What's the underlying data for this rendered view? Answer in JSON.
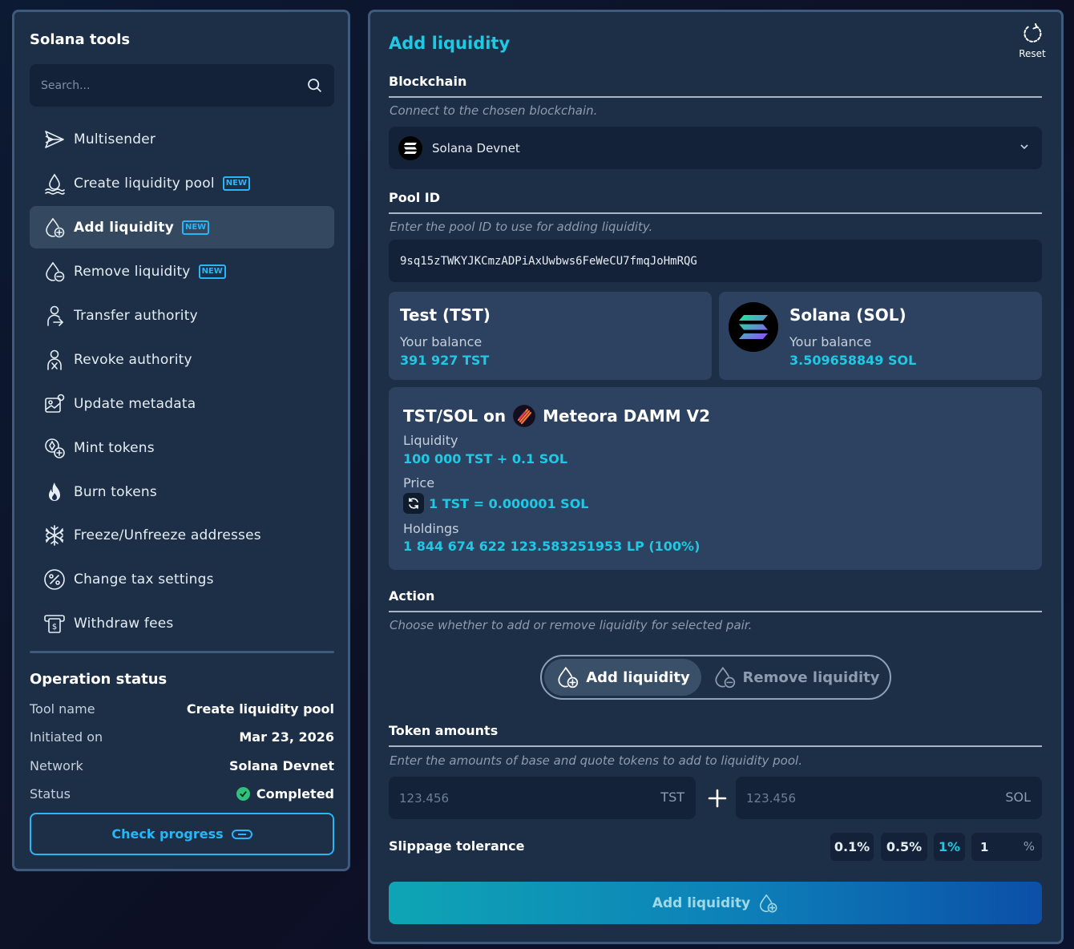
{
  "sidebar": {
    "title": "Solana tools",
    "search_placeholder": "Search...",
    "items": [
      {
        "label": "Multisender",
        "icon": "send-icon",
        "badge": ""
      },
      {
        "label": "Create liquidity pool",
        "icon": "droplet-waves-icon",
        "badge": "NEW"
      },
      {
        "label": "Add liquidity",
        "icon": "droplet-plus-icon",
        "badge": "NEW",
        "active": true
      },
      {
        "label": "Remove liquidity",
        "icon": "droplet-minus-icon",
        "badge": "NEW"
      },
      {
        "label": "Transfer authority",
        "icon": "user-transfer-icon",
        "badge": ""
      },
      {
        "label": "Revoke authority",
        "icon": "user-x-icon",
        "badge": ""
      },
      {
        "label": "Update metadata",
        "icon": "image-edit-icon",
        "badge": ""
      },
      {
        "label": "Mint tokens",
        "icon": "coins-plus-icon",
        "badge": ""
      },
      {
        "label": "Burn tokens",
        "icon": "flame-icon",
        "badge": ""
      },
      {
        "label": "Freeze/Unfreeze addresses",
        "icon": "snowflake-icon",
        "badge": ""
      },
      {
        "label": "Change tax settings",
        "icon": "percent-icon",
        "badge": ""
      },
      {
        "label": "Withdraw fees",
        "icon": "cash-withdraw-icon",
        "badge": ""
      }
    ],
    "status": {
      "title": "Operation status",
      "rows": [
        {
          "key": "Tool name",
          "value": "Create liquidity pool"
        },
        {
          "key": "Initiated on",
          "value": "Mar 23, 2026"
        },
        {
          "key": "Network",
          "value": "Solana Devnet"
        },
        {
          "key": "Status",
          "value": "Completed"
        }
      ],
      "button_label": "Check progress"
    }
  },
  "main": {
    "title": "Add liquidity",
    "reset_label": "Reset",
    "blockchain": {
      "label": "Blockchain",
      "hint": "Connect to the chosen blockchain.",
      "selected": "Solana Devnet"
    },
    "pool": {
      "label": "Pool ID",
      "hint": "Enter the pool ID to use for adding liquidity.",
      "value": "9sq15zTWKYJKCmzADPiAxUwbws6FeWeCU7fmqJoHmRQG"
    },
    "base_token": {
      "name": "Test (TST)",
      "balance_label": "Your balance",
      "balance": "391 927 TST"
    },
    "quote_token": {
      "name": "Solana (SOL)",
      "balance_label": "Your balance",
      "balance": "3.509658849 SOL"
    },
    "pair": {
      "pair_name": "TST/SOL on",
      "dex_name": "Meteora DAMM V2",
      "liquidity_label": "Liquidity",
      "liquidity_value": "100 000 TST + 0.1 SOL",
      "price_label": "Price",
      "price_value": "1 TST = 0.000001 SOL",
      "holdings_label": "Holdings",
      "holdings_value": "1 844 674 622 123.583251953 LP (100%)"
    },
    "action": {
      "label": "Action",
      "hint": "Choose whether to add or remove liquidity for selected pair.",
      "options": [
        "Add liquidity",
        "Remove liquidity"
      ],
      "selected": "Add liquidity"
    },
    "amounts": {
      "label": "Token amounts",
      "hint": "Enter the amounts of base and quote tokens to add to liquidity pool.",
      "base_placeholder": "123.456",
      "base_unit": "TST",
      "quote_placeholder": "123.456",
      "quote_unit": "SOL"
    },
    "slippage": {
      "label": "Slippage tolerance",
      "options": [
        "0.1%",
        "0.5%",
        "1%"
      ],
      "selected": "1%",
      "custom_value": "1",
      "custom_unit": "%"
    },
    "submit_label": "Add liquidity"
  },
  "colors": {
    "accent": "#1fc8e3",
    "badge": "#29b6f6",
    "panel": "#1c2f47",
    "card": "#2c4260",
    "success": "#2fc27a"
  }
}
